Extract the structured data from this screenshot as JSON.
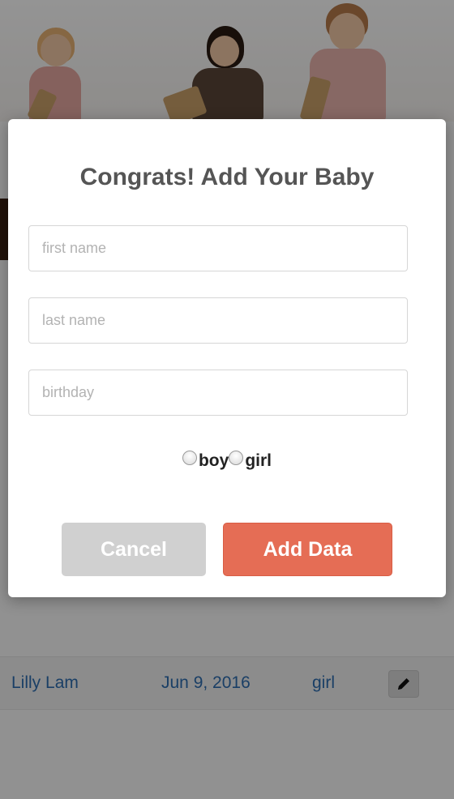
{
  "modal": {
    "title": "Congrats! Add Your Baby",
    "fields": {
      "first_name_placeholder": "first name",
      "last_name_placeholder": "last name",
      "birthday_placeholder": "birthday"
    },
    "gender_options": [
      "boy",
      "girl"
    ],
    "cancel_label": "Cancel",
    "add_label": "Add Data"
  },
  "background": {
    "row": {
      "name": "Lilly Lam",
      "date": "Jun 9, 2016",
      "gender": "girl"
    }
  },
  "icons": {
    "edit": "pencil-icon"
  },
  "colors": {
    "primary_button": "#e56d55",
    "cancel_button": "#d0d0d0",
    "title_text": "#555555",
    "link_text": "#2e6db0"
  }
}
